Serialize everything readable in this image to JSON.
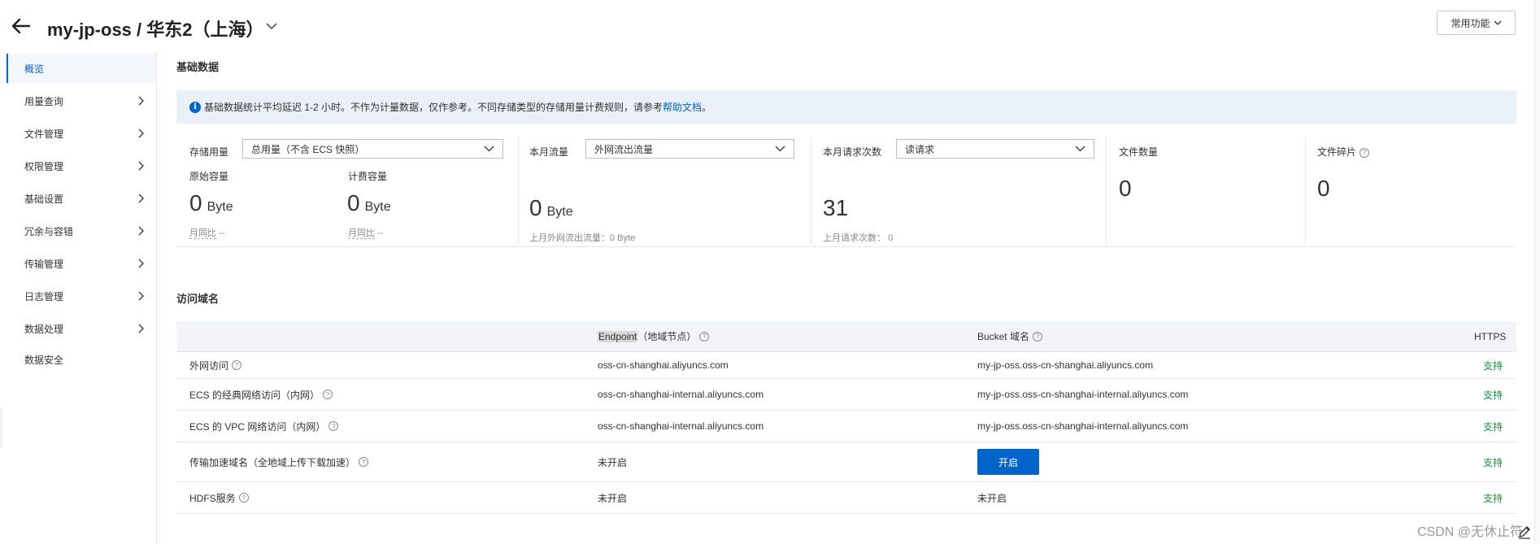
{
  "header": {
    "title": "my-jp-oss / 华东2（上海）",
    "common_functions": "常用功能"
  },
  "sidebar": {
    "items": [
      {
        "label": "概览",
        "active": true,
        "has_chevron": false
      },
      {
        "label": "用量查询",
        "active": false,
        "has_chevron": true
      },
      {
        "label": "文件管理",
        "active": false,
        "has_chevron": true
      },
      {
        "label": "权限管理",
        "active": false,
        "has_chevron": true
      },
      {
        "label": "基础设置",
        "active": false,
        "has_chevron": true
      },
      {
        "label": "冗余与容错",
        "active": false,
        "has_chevron": true
      },
      {
        "label": "传输管理",
        "active": false,
        "has_chevron": true
      },
      {
        "label": "日志管理",
        "active": false,
        "has_chevron": true
      },
      {
        "label": "数据处理",
        "active": false,
        "has_chevron": true
      },
      {
        "label": "数据安全",
        "active": false,
        "has_chevron": false
      }
    ]
  },
  "basic": {
    "title": "基础数据",
    "notice_text": "基础数据统计平均延迟 1-2 小时。不作为计量数据，仅作参考。不同存储类型的存储用量计费规则，请参考",
    "notice_link": "帮助文档",
    "notice_end": "。",
    "storage": {
      "label": "存储用量",
      "select_value": "总用量（不含 ECS 快照）",
      "raw_label": "原始容量",
      "raw_value": "0",
      "raw_unit": "Byte",
      "raw_mom": "月同比",
      "raw_mom_value": "--",
      "billed_label": "计费容量",
      "billed_value": "0",
      "billed_unit": "Byte",
      "billed_mom": "月同比",
      "billed_mom_value": "--"
    },
    "traffic": {
      "label": "本月流量",
      "select_value": "外网流出流量",
      "value": "0",
      "unit": "Byte",
      "last_month": "上月外网流出流量：0 Byte"
    },
    "requests": {
      "label": "本月请求次数",
      "select_value": "读请求",
      "value": "31",
      "last_month_label": "上月请求次数：",
      "last_month_value": "0"
    },
    "file_count": {
      "label": "文件数量",
      "value": "0"
    },
    "fragments": {
      "label": "文件碎片",
      "value": "0"
    }
  },
  "domains": {
    "title": "访问域名",
    "headers": {
      "endpoint": "Endpoint",
      "endpoint_suffix": "（地域节点）",
      "bucket": "Bucket 域名",
      "https": "HTTPS"
    },
    "rows": [
      {
        "name": "外网访问",
        "endpoint": "oss-cn-shanghai.aliyuncs.com",
        "bucket": "my-jp-oss.oss-cn-shanghai.aliyuncs.com",
        "https": "支持"
      },
      {
        "name": "ECS 的经典网络访问（内网）",
        "endpoint": "oss-cn-shanghai-internal.aliyuncs.com",
        "bucket": "my-jp-oss.oss-cn-shanghai-internal.aliyuncs.com",
        "https": "支持"
      },
      {
        "name": "ECS 的 VPC 网络访问（内网）",
        "endpoint": "oss-cn-shanghai-internal.aliyuncs.com",
        "bucket": "my-jp-oss.oss-cn-shanghai-internal.aliyuncs.com",
        "https": "支持"
      },
      {
        "name": "传输加速域名（全地域上传下载加速）",
        "endpoint": "未开启",
        "bucket_button": "开启",
        "https": "支持"
      },
      {
        "name": "HDFS服务",
        "endpoint": "未开启",
        "bucket": "未开启",
        "https": "支持"
      }
    ]
  },
  "watermark": "CSDN @无休止符",
  "colors": {
    "accent": "#0064c8",
    "support": "#1e8e3e",
    "notice_bg": "#eaf0f7"
  }
}
